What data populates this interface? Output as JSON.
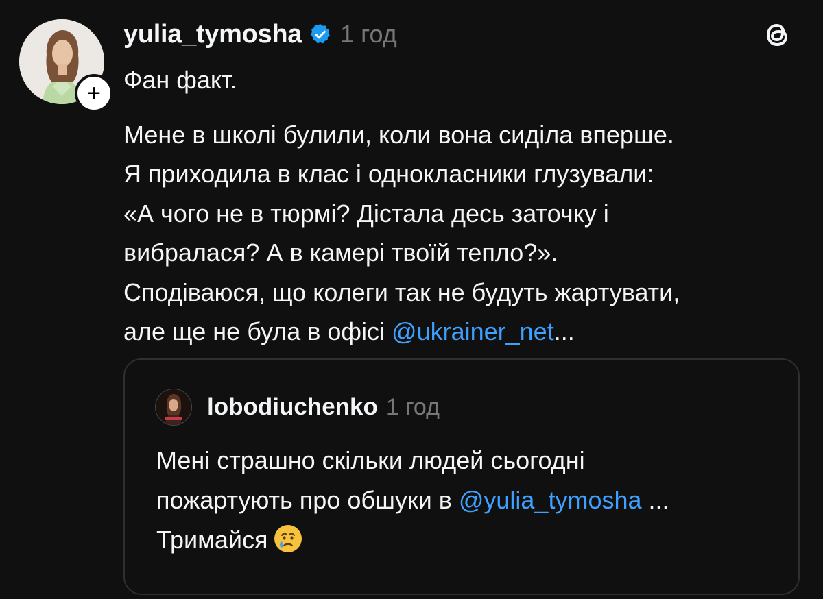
{
  "post": {
    "username": "yulia_tymosha",
    "timestamp": "1 год",
    "follow_symbol": "+",
    "lines_first": "Фан факт.",
    "lines": [
      "Мене в школі булили, коли вона сиділа вперше.",
      "Я приходила в клас і однокласники глузували:",
      "«А чого не в тюрмі? Дістала десь заточку і",
      "вибралася? А в камері твоїй тепло?».",
      "Сподіваюся, що колеги так не будуть жартувати,"
    ],
    "last_line_prefix": "але ще не була в офісі ",
    "last_line_mention": "@ukrainer_net",
    "last_line_suffix": "..."
  },
  "quote": {
    "username": "lobodiuchenko",
    "timestamp": "1 год",
    "line1": "Мені страшно скільки людей сьогодні",
    "line2_prefix": "пожартують про обшуки в ",
    "line2_mention": "@yulia_tymosha",
    "line2_suffix": " ...",
    "line3": "Тримайся"
  },
  "icons": {
    "verified": "verified-badge-icon",
    "threads": "threads-logo-icon",
    "emoji": "crying-face-emoji"
  },
  "colors": {
    "background": "#101010",
    "text": "#f3f5f7",
    "muted": "#777777",
    "mention": "#3ea0ff",
    "verified": "#1d9bf0"
  }
}
